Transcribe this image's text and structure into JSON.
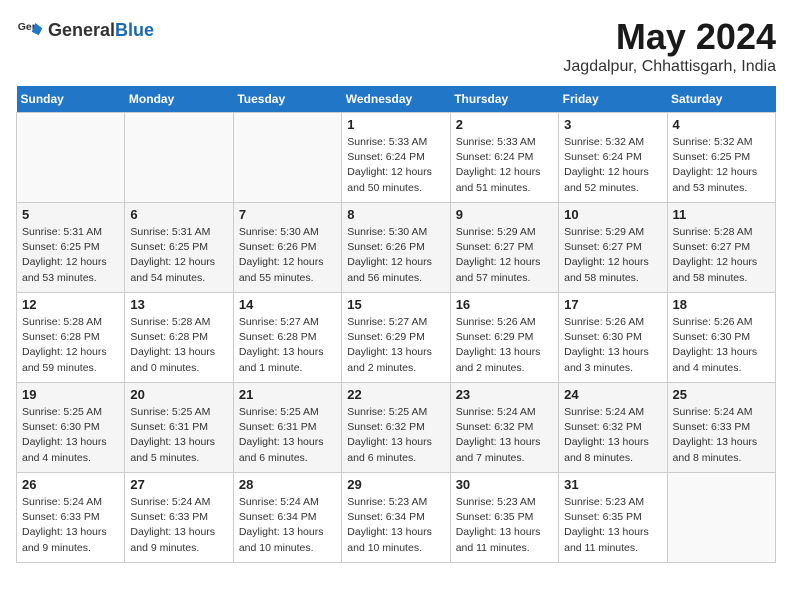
{
  "header": {
    "logo_general": "General",
    "logo_blue": "Blue",
    "month": "May 2024",
    "location": "Jagdalpur, Chhattisgarh, India"
  },
  "days_of_week": [
    "Sunday",
    "Monday",
    "Tuesday",
    "Wednesday",
    "Thursday",
    "Friday",
    "Saturday"
  ],
  "weeks": [
    [
      {
        "day": "",
        "info": ""
      },
      {
        "day": "",
        "info": ""
      },
      {
        "day": "",
        "info": ""
      },
      {
        "day": "1",
        "info": "Sunrise: 5:33 AM\nSunset: 6:24 PM\nDaylight: 12 hours\nand 50 minutes."
      },
      {
        "day": "2",
        "info": "Sunrise: 5:33 AM\nSunset: 6:24 PM\nDaylight: 12 hours\nand 51 minutes."
      },
      {
        "day": "3",
        "info": "Sunrise: 5:32 AM\nSunset: 6:24 PM\nDaylight: 12 hours\nand 52 minutes."
      },
      {
        "day": "4",
        "info": "Sunrise: 5:32 AM\nSunset: 6:25 PM\nDaylight: 12 hours\nand 53 minutes."
      }
    ],
    [
      {
        "day": "5",
        "info": "Sunrise: 5:31 AM\nSunset: 6:25 PM\nDaylight: 12 hours\nand 53 minutes."
      },
      {
        "day": "6",
        "info": "Sunrise: 5:31 AM\nSunset: 6:25 PM\nDaylight: 12 hours\nand 54 minutes."
      },
      {
        "day": "7",
        "info": "Sunrise: 5:30 AM\nSunset: 6:26 PM\nDaylight: 12 hours\nand 55 minutes."
      },
      {
        "day": "8",
        "info": "Sunrise: 5:30 AM\nSunset: 6:26 PM\nDaylight: 12 hours\nand 56 minutes."
      },
      {
        "day": "9",
        "info": "Sunrise: 5:29 AM\nSunset: 6:27 PM\nDaylight: 12 hours\nand 57 minutes."
      },
      {
        "day": "10",
        "info": "Sunrise: 5:29 AM\nSunset: 6:27 PM\nDaylight: 12 hours\nand 58 minutes."
      },
      {
        "day": "11",
        "info": "Sunrise: 5:28 AM\nSunset: 6:27 PM\nDaylight: 12 hours\nand 58 minutes."
      }
    ],
    [
      {
        "day": "12",
        "info": "Sunrise: 5:28 AM\nSunset: 6:28 PM\nDaylight: 12 hours\nand 59 minutes."
      },
      {
        "day": "13",
        "info": "Sunrise: 5:28 AM\nSunset: 6:28 PM\nDaylight: 13 hours\nand 0 minutes."
      },
      {
        "day": "14",
        "info": "Sunrise: 5:27 AM\nSunset: 6:28 PM\nDaylight: 13 hours\nand 1 minute."
      },
      {
        "day": "15",
        "info": "Sunrise: 5:27 AM\nSunset: 6:29 PM\nDaylight: 13 hours\nand 2 minutes."
      },
      {
        "day": "16",
        "info": "Sunrise: 5:26 AM\nSunset: 6:29 PM\nDaylight: 13 hours\nand 2 minutes."
      },
      {
        "day": "17",
        "info": "Sunrise: 5:26 AM\nSunset: 6:30 PM\nDaylight: 13 hours\nand 3 minutes."
      },
      {
        "day": "18",
        "info": "Sunrise: 5:26 AM\nSunset: 6:30 PM\nDaylight: 13 hours\nand 4 minutes."
      }
    ],
    [
      {
        "day": "19",
        "info": "Sunrise: 5:25 AM\nSunset: 6:30 PM\nDaylight: 13 hours\nand 4 minutes."
      },
      {
        "day": "20",
        "info": "Sunrise: 5:25 AM\nSunset: 6:31 PM\nDaylight: 13 hours\nand 5 minutes."
      },
      {
        "day": "21",
        "info": "Sunrise: 5:25 AM\nSunset: 6:31 PM\nDaylight: 13 hours\nand 6 minutes."
      },
      {
        "day": "22",
        "info": "Sunrise: 5:25 AM\nSunset: 6:32 PM\nDaylight: 13 hours\nand 6 minutes."
      },
      {
        "day": "23",
        "info": "Sunrise: 5:24 AM\nSunset: 6:32 PM\nDaylight: 13 hours\nand 7 minutes."
      },
      {
        "day": "24",
        "info": "Sunrise: 5:24 AM\nSunset: 6:32 PM\nDaylight: 13 hours\nand 8 minutes."
      },
      {
        "day": "25",
        "info": "Sunrise: 5:24 AM\nSunset: 6:33 PM\nDaylight: 13 hours\nand 8 minutes."
      }
    ],
    [
      {
        "day": "26",
        "info": "Sunrise: 5:24 AM\nSunset: 6:33 PM\nDaylight: 13 hours\nand 9 minutes."
      },
      {
        "day": "27",
        "info": "Sunrise: 5:24 AM\nSunset: 6:33 PM\nDaylight: 13 hours\nand 9 minutes."
      },
      {
        "day": "28",
        "info": "Sunrise: 5:24 AM\nSunset: 6:34 PM\nDaylight: 13 hours\nand 10 minutes."
      },
      {
        "day": "29",
        "info": "Sunrise: 5:23 AM\nSunset: 6:34 PM\nDaylight: 13 hours\nand 10 minutes."
      },
      {
        "day": "30",
        "info": "Sunrise: 5:23 AM\nSunset: 6:35 PM\nDaylight: 13 hours\nand 11 minutes."
      },
      {
        "day": "31",
        "info": "Sunrise: 5:23 AM\nSunset: 6:35 PM\nDaylight: 13 hours\nand 11 minutes."
      },
      {
        "day": "",
        "info": ""
      }
    ]
  ]
}
